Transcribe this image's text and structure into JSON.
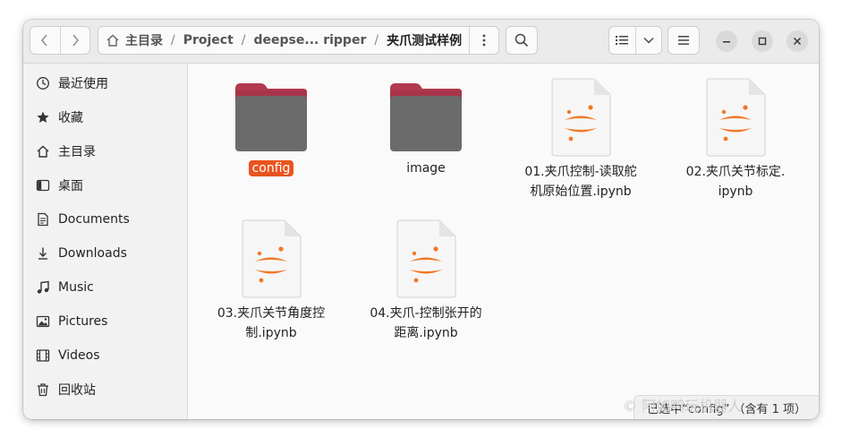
{
  "headerbar": {
    "back_icon": "chevron-left-icon",
    "forward_icon": "chevron-right-icon",
    "path": {
      "home_label": "主目录",
      "segments": [
        "Project",
        "deepse... ripper"
      ],
      "current": "夹爪测试样例",
      "separator": "/"
    },
    "search_icon": "search-icon",
    "view_icon": "list-view-icon",
    "menu_icon": "hamburger-menu-icon"
  },
  "sidebar": {
    "items": [
      {
        "label": "最近使用",
        "icon": "clock-icon"
      },
      {
        "label": "收藏",
        "icon": "star-icon"
      },
      {
        "label": "主目录",
        "icon": "home-icon"
      },
      {
        "label": "桌面",
        "icon": "desktop-icon"
      },
      {
        "label": "Documents",
        "icon": "document-icon"
      },
      {
        "label": "Downloads",
        "icon": "download-icon"
      },
      {
        "label": "Music",
        "icon": "music-icon"
      },
      {
        "label": "Pictures",
        "icon": "picture-icon"
      },
      {
        "label": "Videos",
        "icon": "video-icon"
      },
      {
        "label": "回收站",
        "icon": "trash-icon"
      }
    ]
  },
  "files": [
    {
      "name": "config",
      "type": "folder",
      "selected": true
    },
    {
      "name": "image",
      "type": "folder",
      "selected": false
    },
    {
      "name_line1": "01.夹爪控制-读取舵",
      "name_line2": "机原始位置.ipynb",
      "type": "notebook"
    },
    {
      "name_line1": "02.夹爪关节标定.",
      "name_line2": "ipynb",
      "type": "notebook"
    },
    {
      "name_line1": "03.夹爪关节角度控",
      "name_line2": "制.ipynb",
      "type": "notebook"
    },
    {
      "name_line1": "04.夹爪-控制张开的",
      "name_line2": "距离.ipynb",
      "type": "notebook"
    }
  ],
  "status": "已选中“config” （含有 1 项）",
  "watermark": "© 阿如鸭玩机器人",
  "colors": {
    "accent": "#e95420",
    "folder_top": "#b23a4e",
    "folder_body": "#6b6b6b",
    "jupyter": "#f37726"
  }
}
